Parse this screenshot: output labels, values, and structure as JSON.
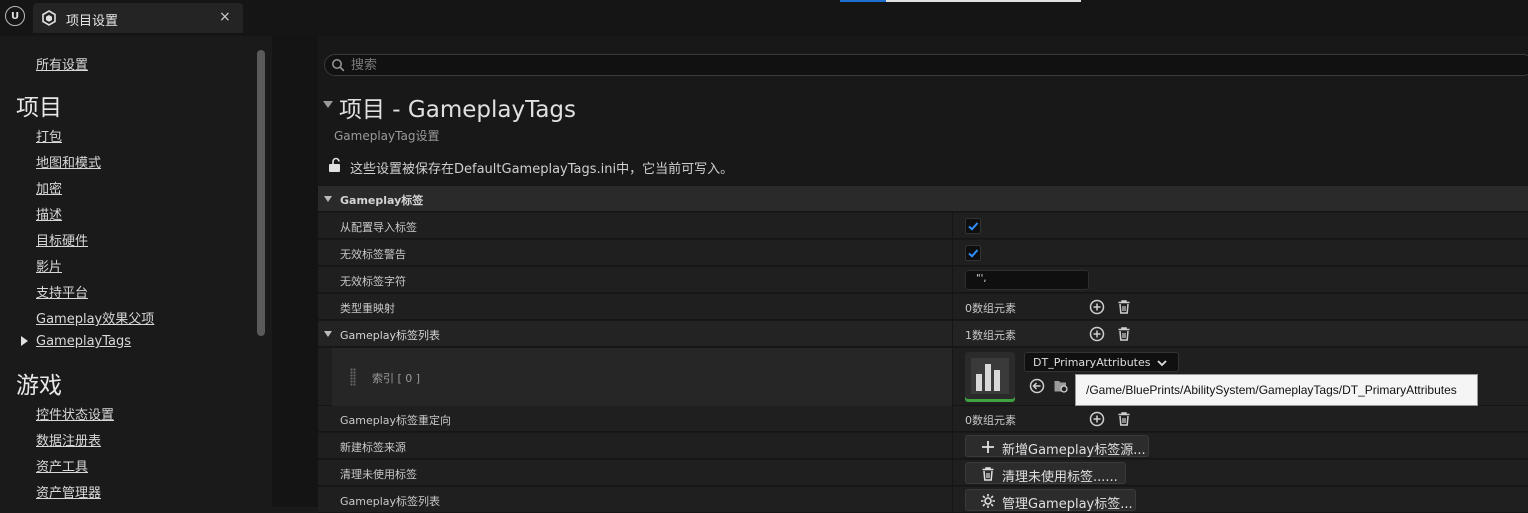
{
  "window": {
    "tab_title": "项目设置",
    "close_glyph": "×",
    "logo_text": "U"
  },
  "sidebar": {
    "all_settings": "所有设置",
    "project_header": "项目",
    "project_items": [
      "打包",
      "地图和模式",
      "加密",
      "描述",
      "目标硬件",
      "影片",
      "支持平台",
      "Gameplay效果父项",
      "GameplayTags"
    ],
    "game_header": "游戏",
    "game_items": [
      "控件状态设置",
      "数据注册表",
      "资产工具",
      "资产管理器"
    ]
  },
  "search": {
    "placeholder": "搜索"
  },
  "section": {
    "title": "项目 - GameplayTags",
    "subtitle": "GameplayTag设置",
    "save_note": "这些设置被保存在DefaultGameplayTags.ini中，它当前可写入。"
  },
  "grid": {
    "category": "Gameplay标签",
    "rows": {
      "import_from_config": {
        "label": "从配置导入标签",
        "checked": true
      },
      "invalid_tag_warning": {
        "label": "无效标签警告",
        "checked": true
      },
      "invalid_tag_chars": {
        "label": "无效标签字符",
        "value": "\"',"
      },
      "type_remap": {
        "label": "类型重映射",
        "value": "0数组元素"
      },
      "tag_table_list": {
        "label": "Gameplay标签列表",
        "value": "1数组元素"
      },
      "array_element": {
        "index_label": "索引 [ 0 ]",
        "asset_name": "DT_PrimaryAttributes",
        "tooltip": "/Game/BluePrints/AbilitySystem/GameplayTags/DT_PrimaryAttributes"
      },
      "tag_redirects": {
        "label": "Gameplay标签重定向",
        "value": "0数组元素"
      },
      "new_tag_source": {
        "label": "新建标签来源",
        "button": "新增Gameplay标签源..."
      },
      "cleanup_unused": {
        "label": "清理未使用标签",
        "button": "清理未使用标签......"
      },
      "tag_list": {
        "label": "Gameplay标签列表",
        "button": "管理Gameplay标签..."
      }
    }
  },
  "colors": {
    "accent_blue": "#1f6fd1",
    "check_blue": "#2f8fff",
    "thumb_green": "#3ea33e"
  },
  "icons": [
    "unreal-logo-icon",
    "project-settings-icon",
    "close-icon",
    "search-icon",
    "lock-icon",
    "checkmark-icon",
    "add-element-icon",
    "delete-icon",
    "datatable-thumbnail-icon",
    "chevron-down-icon",
    "use-selected-icon",
    "browse-asset-icon",
    "plus-icon",
    "trash-icon",
    "gear-icon"
  ]
}
